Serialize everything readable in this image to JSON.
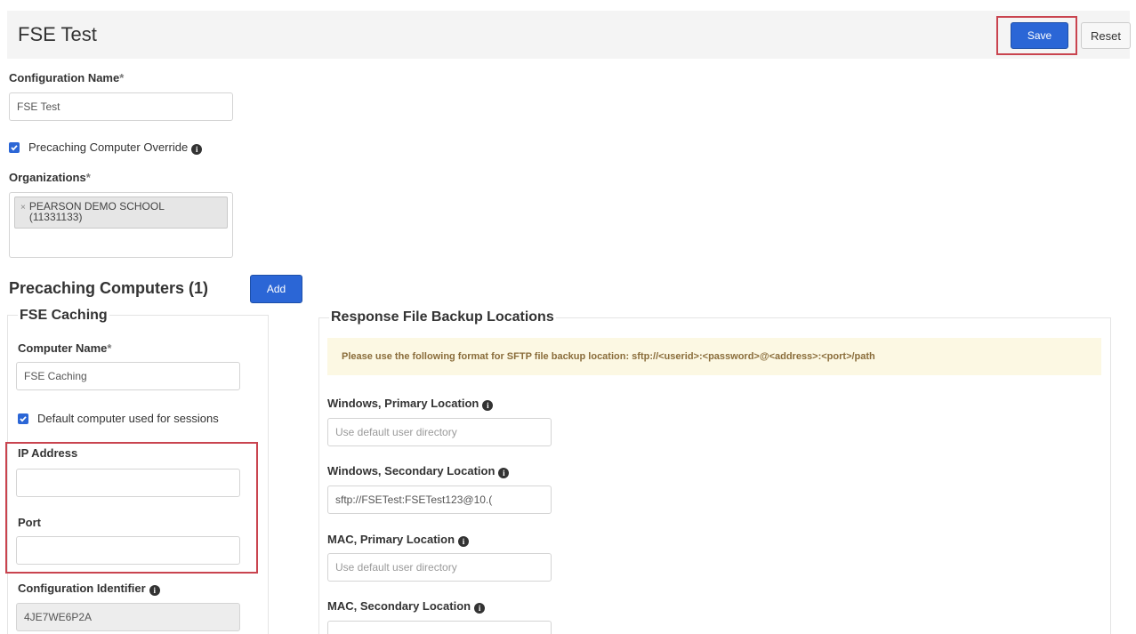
{
  "header": {
    "title": "FSE Test",
    "save_label": "Save",
    "reset_label": "Reset"
  },
  "config": {
    "name_label": "Configuration Name",
    "name_value": "FSE Test",
    "override_label": "Precaching Computer Override",
    "organizations_label": "Organizations",
    "organization_tag": "PEARSON DEMO SCHOOL (11331133)",
    "required_mark": "*"
  },
  "precaching": {
    "heading": "Precaching Computers (1)",
    "add_label": "Add"
  },
  "computer": {
    "heading": "FSE Caching",
    "name_label": "Computer Name",
    "name_value": "FSE Caching",
    "default_label": "Default computer used for sessions",
    "ip_label": "IP Address",
    "ip_value": "",
    "port_label": "Port",
    "port_value": "",
    "config_id_label": "Configuration Identifier",
    "config_id_value": "4JE7WE6P2A"
  },
  "backup": {
    "heading": "Response File Backup Locations",
    "notice": "Please use the following format for SFTP file backup location: sftp://<userid>:<password>@<address>:<port>/path",
    "win_primary_label": "Windows, Primary Location",
    "win_primary_placeholder": "Use default user directory",
    "win_secondary_label": "Windows, Secondary Location",
    "win_secondary_value": "sftp://FSETest:FSETest123@10.(",
    "mac_primary_label": "MAC, Primary Location",
    "mac_primary_placeholder": "Use default user directory",
    "mac_secondary_label": "MAC, Secondary Location",
    "mac_secondary_value": ""
  },
  "icons": {
    "info": "i",
    "check": "✓",
    "remove": "×"
  },
  "colors": {
    "primary": "#2b66d6",
    "highlight": "#c9444f",
    "notice_bg": "#fcf8e3"
  }
}
